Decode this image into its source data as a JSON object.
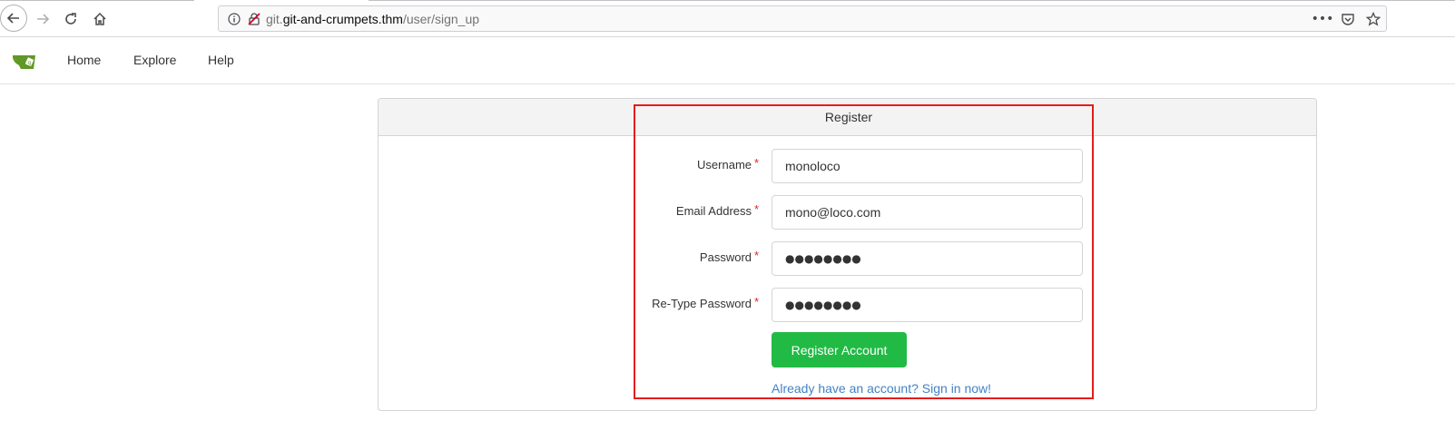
{
  "browser": {
    "url_prefix": "git.",
    "url_host": "git-and-crumpets.thm",
    "url_path": "/user/sign_up",
    "icons": {
      "back": "back-arrow-icon",
      "forward": "forward-arrow-icon",
      "reload": "reload-icon",
      "home": "home-icon",
      "info": "info-icon",
      "insecure": "insecure-lock-icon",
      "menu": "more-icon",
      "pocket": "pocket-icon",
      "bookmark": "star-icon"
    }
  },
  "nav": {
    "logo": "gitea-teacup-logo",
    "items": [
      {
        "label": "Home"
      },
      {
        "label": "Explore"
      },
      {
        "label": "Help"
      }
    ]
  },
  "form": {
    "title": "Register",
    "fields": [
      {
        "label": "Username",
        "value": "monoloco",
        "required": "*"
      },
      {
        "label": "Email Address",
        "value": "mono@loco.com",
        "required": "*"
      },
      {
        "label": "Password",
        "value": "●●●●●●●●",
        "required": "*"
      },
      {
        "label": "Re-Type Password",
        "value": "●●●●●●●●",
        "required": "*"
      }
    ],
    "submit_label": "Register Account",
    "signin_link": "Already have an account? Sign in now!"
  },
  "colors": {
    "accent_green": "#21ba45",
    "link_blue": "#4183c4",
    "required_red": "#db2828",
    "annotation_red": "#e41c1c"
  }
}
